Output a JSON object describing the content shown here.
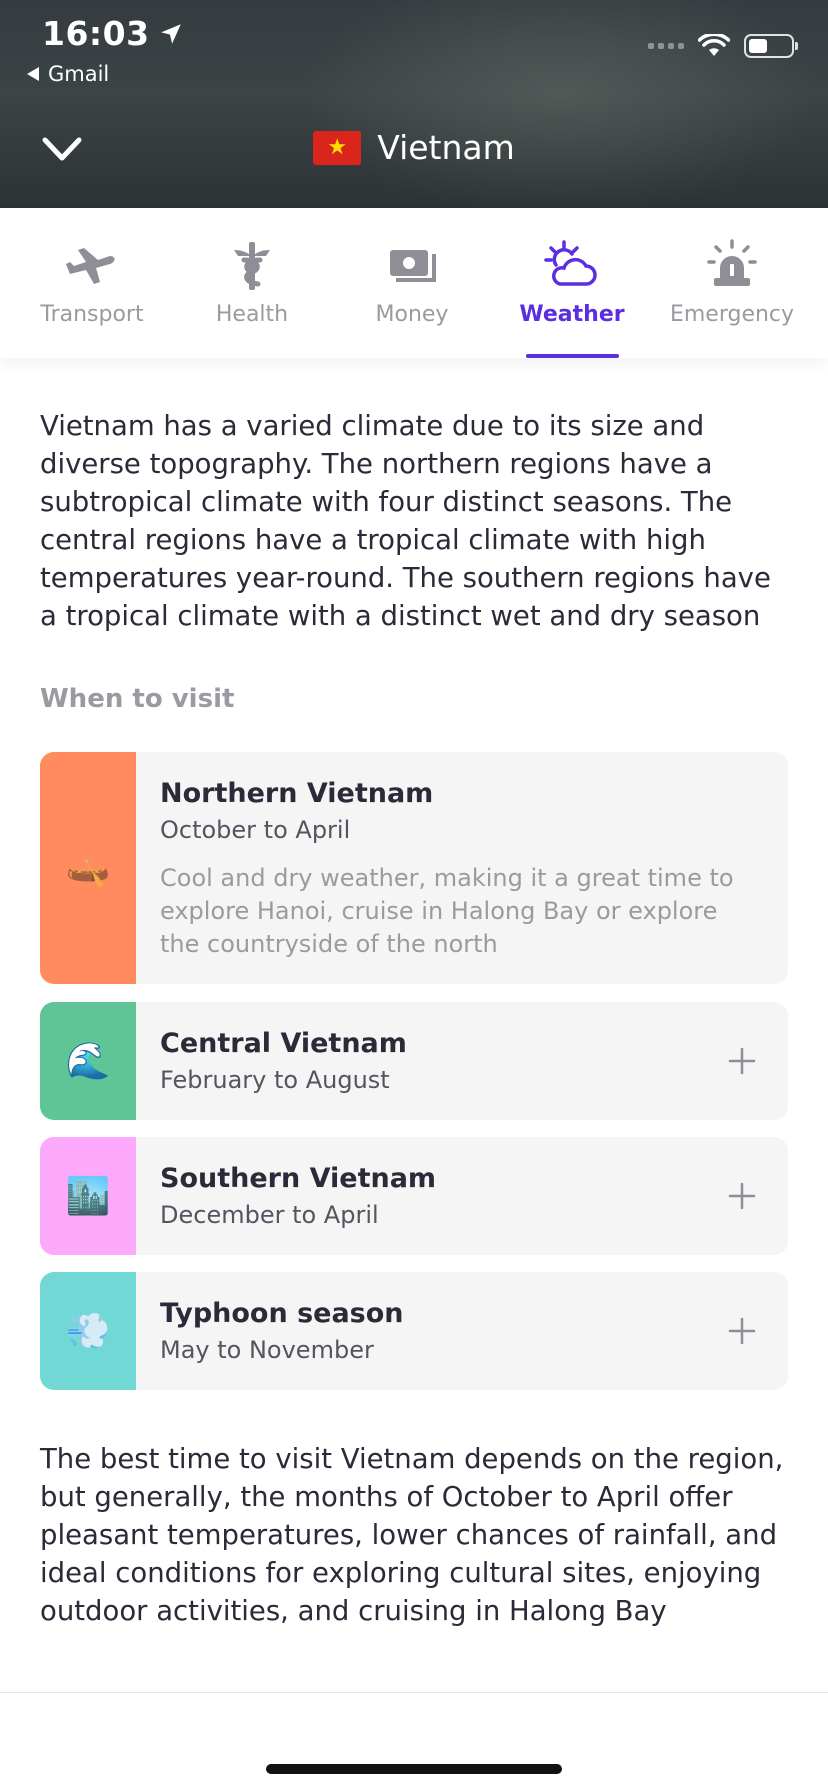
{
  "status_bar": {
    "time": "16:03",
    "back_app": "Gmail",
    "battery_level": 0.45
  },
  "header": {
    "title": "Vietnam",
    "flag_star": "★",
    "flag_colors": {
      "red": "#da251d",
      "star": "#ffde00"
    }
  },
  "tabs": [
    {
      "label": "Transport",
      "icon": "airplane-icon",
      "active": false
    },
    {
      "label": "Health",
      "icon": "caduceus-icon",
      "active": false
    },
    {
      "label": "Money",
      "icon": "money-icon",
      "active": false
    },
    {
      "label": "Weather",
      "icon": "weather-icon",
      "active": true
    },
    {
      "label": "Emergency",
      "icon": "siren-icon",
      "active": false
    }
  ],
  "accent_color": "#5b2ee0",
  "intro_text": "Vietnam has a varied climate due to its size and diverse topography. The northern regions have a subtropical climate with four distinct seasons. The central regions have a tropical climate with high temperatures year-round. The southern regions have a tropical climate with a distinct wet and dry season",
  "when_to_visit": {
    "label": "When to visit",
    "cards": [
      {
        "title": "Northern Vietnam",
        "subtitle": "October to April",
        "description": "Cool and dry weather, making it a great time to explore Hanoi, cruise in Halong Bay or explore the countryside of the north",
        "emoji": "🛶",
        "icon": "canoe-icon",
        "color": "#ff8b5e",
        "expanded": true
      },
      {
        "title": "Central Vietnam",
        "subtitle": "February to August",
        "emoji": "🌊",
        "icon": "wave-icon",
        "color": "#5fc496",
        "expanded": false
      },
      {
        "title": "Southern Vietnam",
        "subtitle": "December to April",
        "emoji": "🏙️",
        "icon": "cityscape-icon",
        "color": "#fca8fb",
        "expanded": false
      },
      {
        "title": "Typhoon season",
        "subtitle": "May to November",
        "emoji": "💨",
        "icon": "wind-icon",
        "color": "#72d8d6",
        "expanded": false
      }
    ]
  },
  "outro_text": "The best time to visit Vietnam depends on the region, but generally, the months of October to April offer pleasant temperatures, lower chances of rainfall, and ideal conditions for exploring cultural sites, enjoying outdoor activities, and cruising in Halong Bay"
}
